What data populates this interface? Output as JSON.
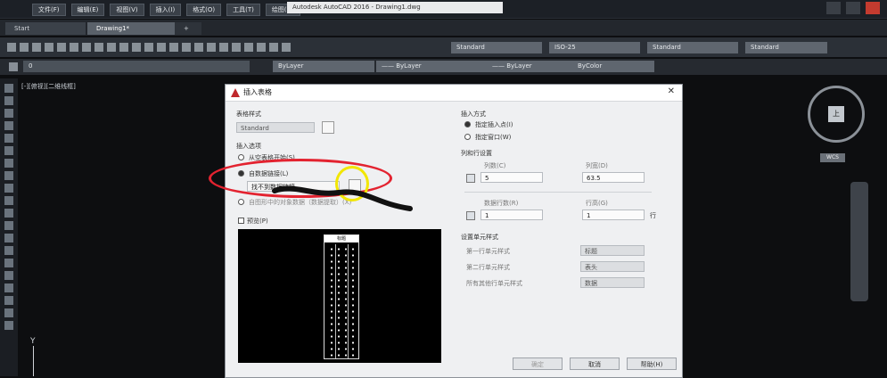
{
  "app": {
    "title": "Autodesk AutoCAD 2016 - Drawing1.dwg",
    "menu": [
      "文件(F)",
      "编辑(E)",
      "视图(V)",
      "插入(I)",
      "格式(O)",
      "工具(T)",
      "绘图(D)"
    ]
  },
  "tabs": [
    {
      "label": "Start"
    },
    {
      "label": "Drawing1*"
    },
    {
      "label": "+"
    }
  ],
  "ribbon": {
    "styles": [
      "Standard",
      "ISO-25",
      "Standard",
      "Standard"
    ],
    "layer_value": "0",
    "props": [
      "ByLayer",
      "—— ByLayer",
      "—— ByLayer",
      "ByColor"
    ]
  },
  "viewport": {
    "label": "[-][俯视][二维线框]",
    "viewcube_face": "上",
    "wcs": "WCS",
    "axis": "Y"
  },
  "dialog": {
    "title": "插入表格",
    "table_style_label": "表格样式",
    "table_style_value": "Standard",
    "insert_options_label": "插入选项",
    "opt_empty": "从空表格开始(S)",
    "opt_data_link": "自数据链接(L)",
    "data_link_value": "找不到数据链接",
    "opt_objects": "自图形中的对象数据（数据提取）(X)",
    "preview_label": "预览(P)",
    "preview_header": "标题",
    "insert_method_label": "插入方式",
    "opt_point": "指定插入点(I)",
    "opt_window": "指定窗口(W)",
    "colrow_label": "列和行设置",
    "columns_label": "列数(C)",
    "columns_value": "5",
    "col_width_label": "列宽(D)",
    "col_width_value": "63.5",
    "rows_label": "数据行数(R)",
    "rows_value": "1",
    "row_height_label": "行高(G)",
    "row_height_value": "1",
    "row_unit": "行",
    "cellstyle_label": "设置单元样式",
    "first_row_label": "第一行单元样式",
    "first_row_value": "标题",
    "second_row_label": "第二行单元样式",
    "second_row_value": "表头",
    "other_rows_label": "所有其他行单元样式",
    "other_rows_value": "数据",
    "ok": "确定",
    "cancel": "取消",
    "help": "帮助(H)"
  }
}
